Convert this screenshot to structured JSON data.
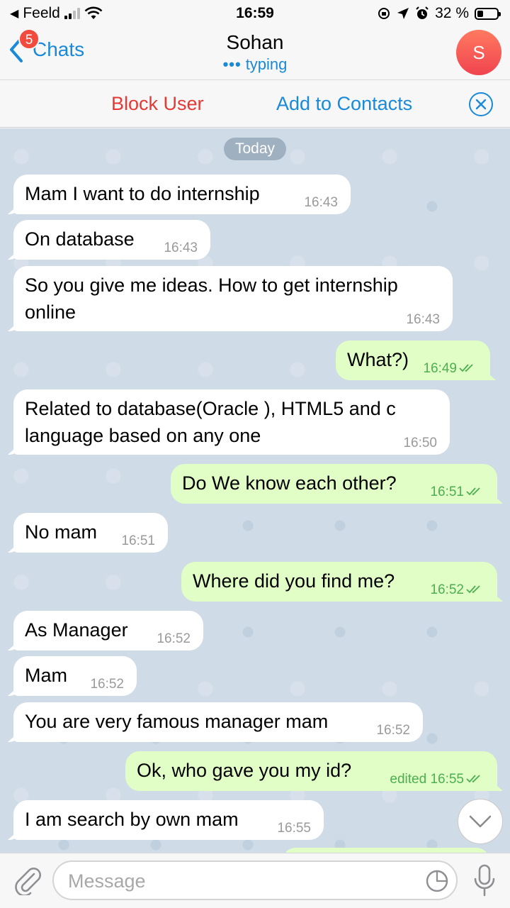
{
  "status_bar": {
    "carrier": "Feeld",
    "time": "16:59",
    "battery": "32 %",
    "battery_level": 0.32
  },
  "header": {
    "back_label": "Chats",
    "unread_badge": "5",
    "title": "Sohan",
    "status_dots": "•••",
    "status": "typing",
    "avatar_letter": "S"
  },
  "actions": {
    "block": "Block User",
    "add_contact": "Add to Contacts"
  },
  "chat": {
    "date_pill": "Today",
    "messages": [
      {
        "dir": "in",
        "text": "Mam I want to do internship",
        "time": "16:43"
      },
      {
        "dir": "in",
        "text": "On database",
        "time": "16:43"
      },
      {
        "dir": "in",
        "text": "So you give me ideas. How to get internship online",
        "time": "16:43"
      },
      {
        "dir": "out",
        "text": "What?)",
        "time": "16:49"
      },
      {
        "dir": "in",
        "text": "Related to database(Oracle ), HTML5 and c language based on any one",
        "time": "16:50"
      },
      {
        "dir": "out",
        "text": "Do We know each other?",
        "time": "16:51"
      },
      {
        "dir": "in",
        "text": "No mam",
        "time": "16:51"
      },
      {
        "dir": "out",
        "text": "Where did you find me?",
        "time": "16:52"
      },
      {
        "dir": "in",
        "text": "As Manager",
        "time": "16:52"
      },
      {
        "dir": "in",
        "text": "Mam",
        "time": "16:52"
      },
      {
        "dir": "in",
        "text": "You are very famous manager mam",
        "time": "16:52"
      },
      {
        "dir": "out",
        "text": "Ok, who gave you my id?",
        "time": "edited 16:55"
      },
      {
        "dir": "in",
        "text": "I am search by own mam",
        "time": "16:55"
      }
    ]
  },
  "composer": {
    "placeholder": "Message"
  },
  "icons": [
    "back-chevron-icon",
    "wifi-icon",
    "location-icon",
    "alarm-icon",
    "close-icon",
    "attach-icon",
    "sticker-icon",
    "mic-icon",
    "chevron-down-icon",
    "double-check-icon"
  ],
  "colors": {
    "accent": "#1a8ad8",
    "danger": "#e53935",
    "outgoing_bubble": "#e1fec6",
    "incoming_bubble": "#ffffff",
    "read_tick": "#4caf50"
  }
}
